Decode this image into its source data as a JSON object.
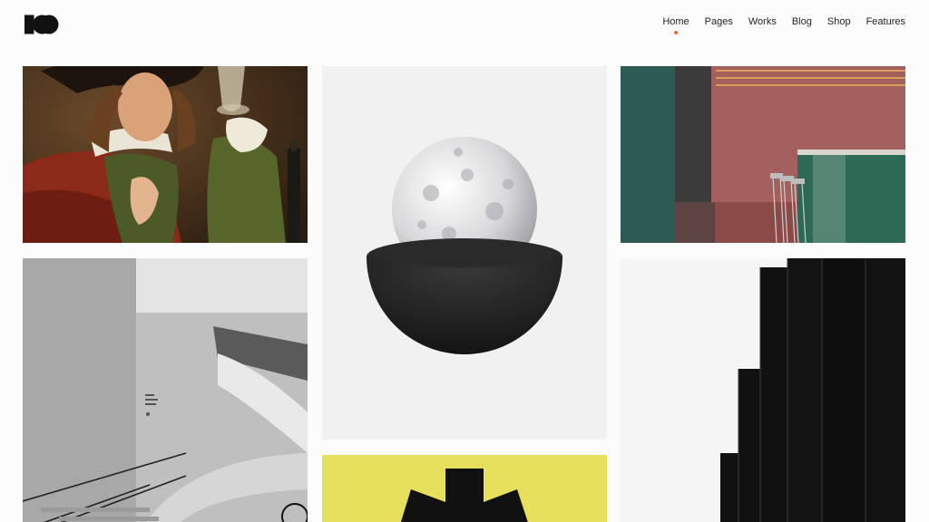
{
  "brand": {
    "logo_icon": "brand-logo-icon",
    "logo_color": "#111111"
  },
  "nav": {
    "items": [
      {
        "label": "Home",
        "active": true
      },
      {
        "label": "Pages",
        "active": false
      },
      {
        "label": "Works",
        "active": false
      },
      {
        "label": "Blog",
        "active": false
      },
      {
        "label": "Shop",
        "active": false
      },
      {
        "label": "Features",
        "active": false
      }
    ],
    "active_indicator_color": "#e86a2c"
  },
  "gallery": {
    "tiles": [
      {
        "icon": "portrait-painting-image"
      },
      {
        "icon": "sphere-in-bowl-image"
      },
      {
        "icon": "pink-bar-interior-image"
      },
      {
        "icon": "concrete-staircase-image"
      },
      {
        "icon": "yellow-abstract-shape-image"
      },
      {
        "icon": "black-panels-image"
      }
    ]
  }
}
